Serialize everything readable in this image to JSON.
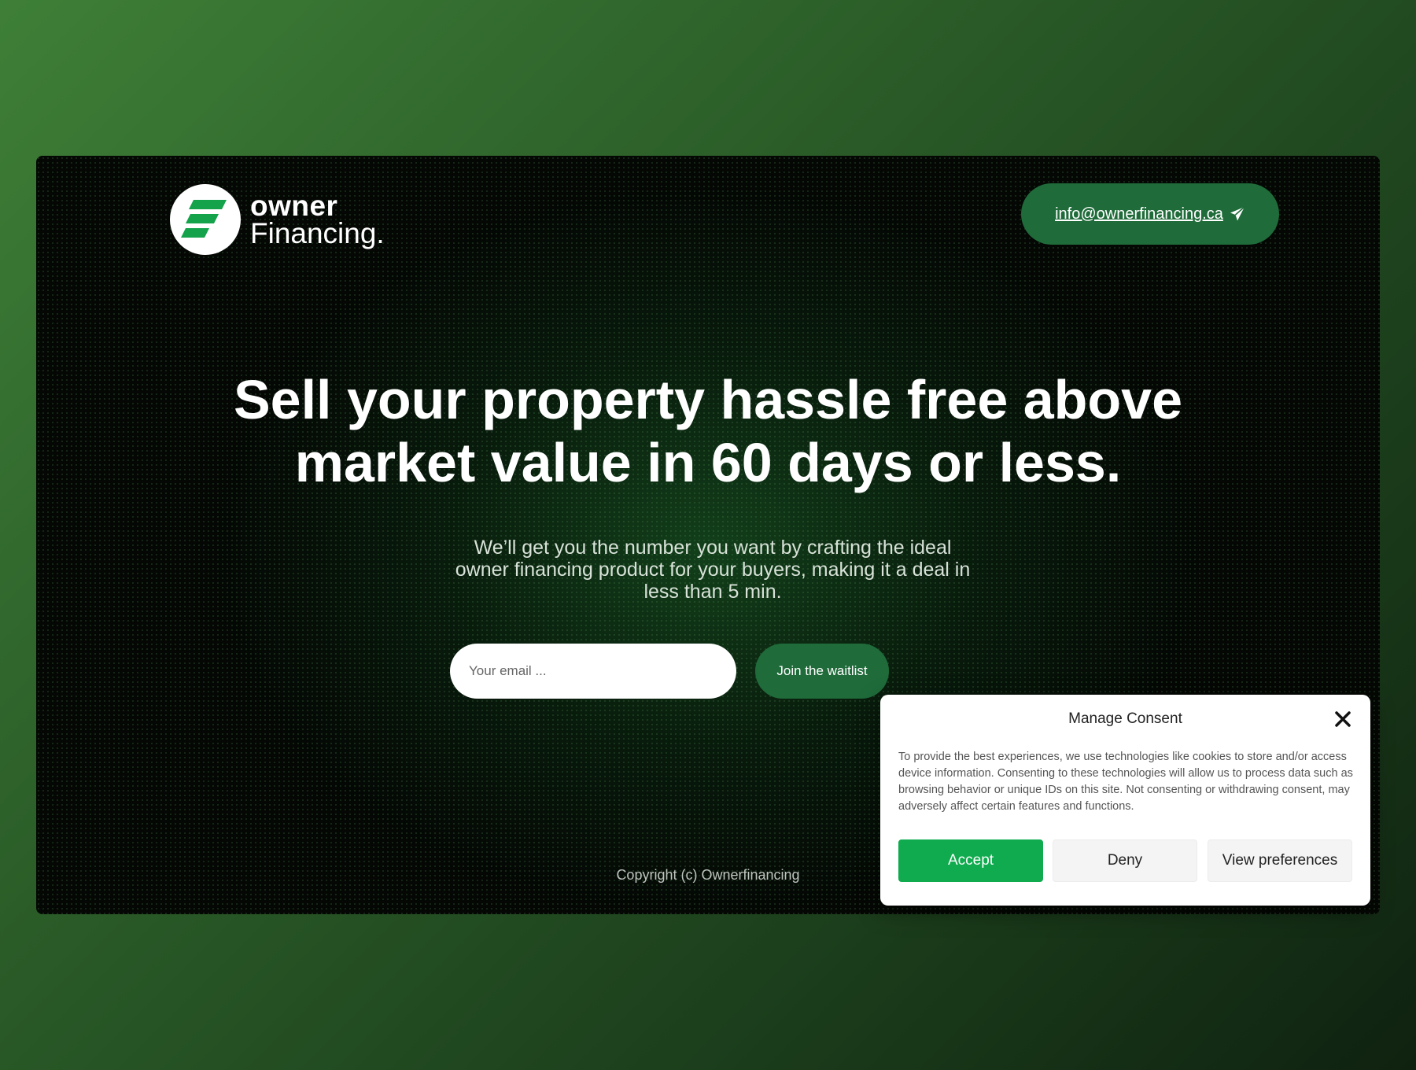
{
  "brand": {
    "name_line1": "owner",
    "name_line2": "Financing."
  },
  "header": {
    "contact_email": "info@ownerfinancing.ca",
    "contact_icon": "paper-plane-icon"
  },
  "hero": {
    "headline_line1": "Sell your property hassle free above",
    "headline_line2": "market value in 60 days or less.",
    "subtext": "We’ll get you the number you want by crafting the ideal owner financing product for your buyers, making it a deal in less than 5 min."
  },
  "signup": {
    "email_placeholder": "Your email ...",
    "email_value": "",
    "submit_label": "Join the waitlist"
  },
  "footer": {
    "copyright": "Copyright (c) Ownerfinancing"
  },
  "consent": {
    "title": "Manage Consent",
    "body": "To provide the best experiences, we use technologies like cookies to store and/or access device information. Consenting to these technologies will allow us to process data such as browsing behavior or unique IDs on this site. Not consenting or withdrawing consent, may adversely affect certain features and functions.",
    "accept_label": "Accept",
    "deny_label": "Deny",
    "preferences_label": "View preferences",
    "close_icon": "close-icon"
  },
  "colors": {
    "brand_green": "#1f6b3a",
    "accept_green": "#0fab4e",
    "logo_green": "#14a24b"
  }
}
